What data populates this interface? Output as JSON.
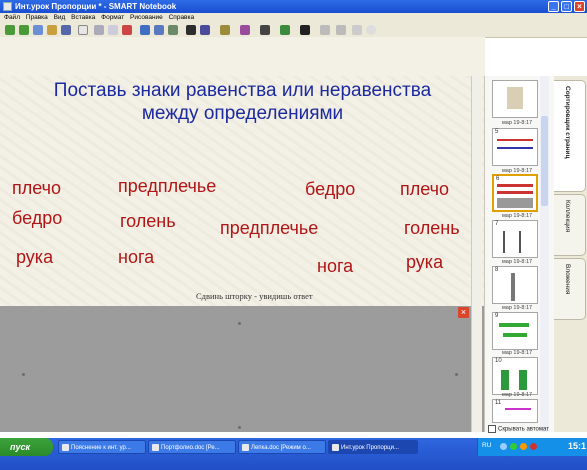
{
  "window": {
    "title": "Инт.урок Пропорции * - SMART Notebook",
    "minimize": "_",
    "maximize": "□",
    "close": "×"
  },
  "menu": [
    "Файл",
    "Правка",
    "Вид",
    "Вставка",
    "Формат",
    "Рисование",
    "Справка"
  ],
  "page": {
    "heading_line1": "Поставь знаки равенства или неравенства",
    "heading_line2": "между определениями",
    "words": {
      "w1": "плечо",
      "w2": "предплечье",
      "w3": "бедро",
      "w4": "плечо",
      "w5": "бедро",
      "w6": "голень",
      "w7": "предплечье",
      "w8": "голень",
      "w9": "рука",
      "w10": "нога",
      "w11": "нога",
      "w12": "рука"
    },
    "hint": "Сдвинь шторку - увидишь ответ"
  },
  "sidebar": {
    "thumb_dates": [
      "мар 19-8:17",
      "мар 19-8:17",
      "мар 19-8:17",
      "мар 19-8:17",
      "мар 19-8:17",
      "мар 19-8:17",
      "мар 19-8:17"
    ],
    "thumb_numbers": [
      "5",
      "6",
      "7",
      "8",
      "9",
      "10",
      "11"
    ],
    "autohide_label": "Скрывать автомат",
    "tabs": [
      "Сортировщик страниц",
      "Коллекция",
      "Вложения"
    ]
  },
  "taskbar": {
    "start_label": "пуск",
    "tasks": [
      "Пояснение к инт. ур...",
      "Портфолио.doc [Ре...",
      "Лепка.doc [Режим о...",
      "Инт.урок Пропорци..."
    ],
    "lang": "RU",
    "clock": "15:1"
  },
  "colors": {
    "heading": "#1c2aa0",
    "words": "#b01616",
    "shade": "#9c9c9c",
    "titlebar": "#2e6be6",
    "taskbar": "#214fc6",
    "start": "#3da33b"
  }
}
